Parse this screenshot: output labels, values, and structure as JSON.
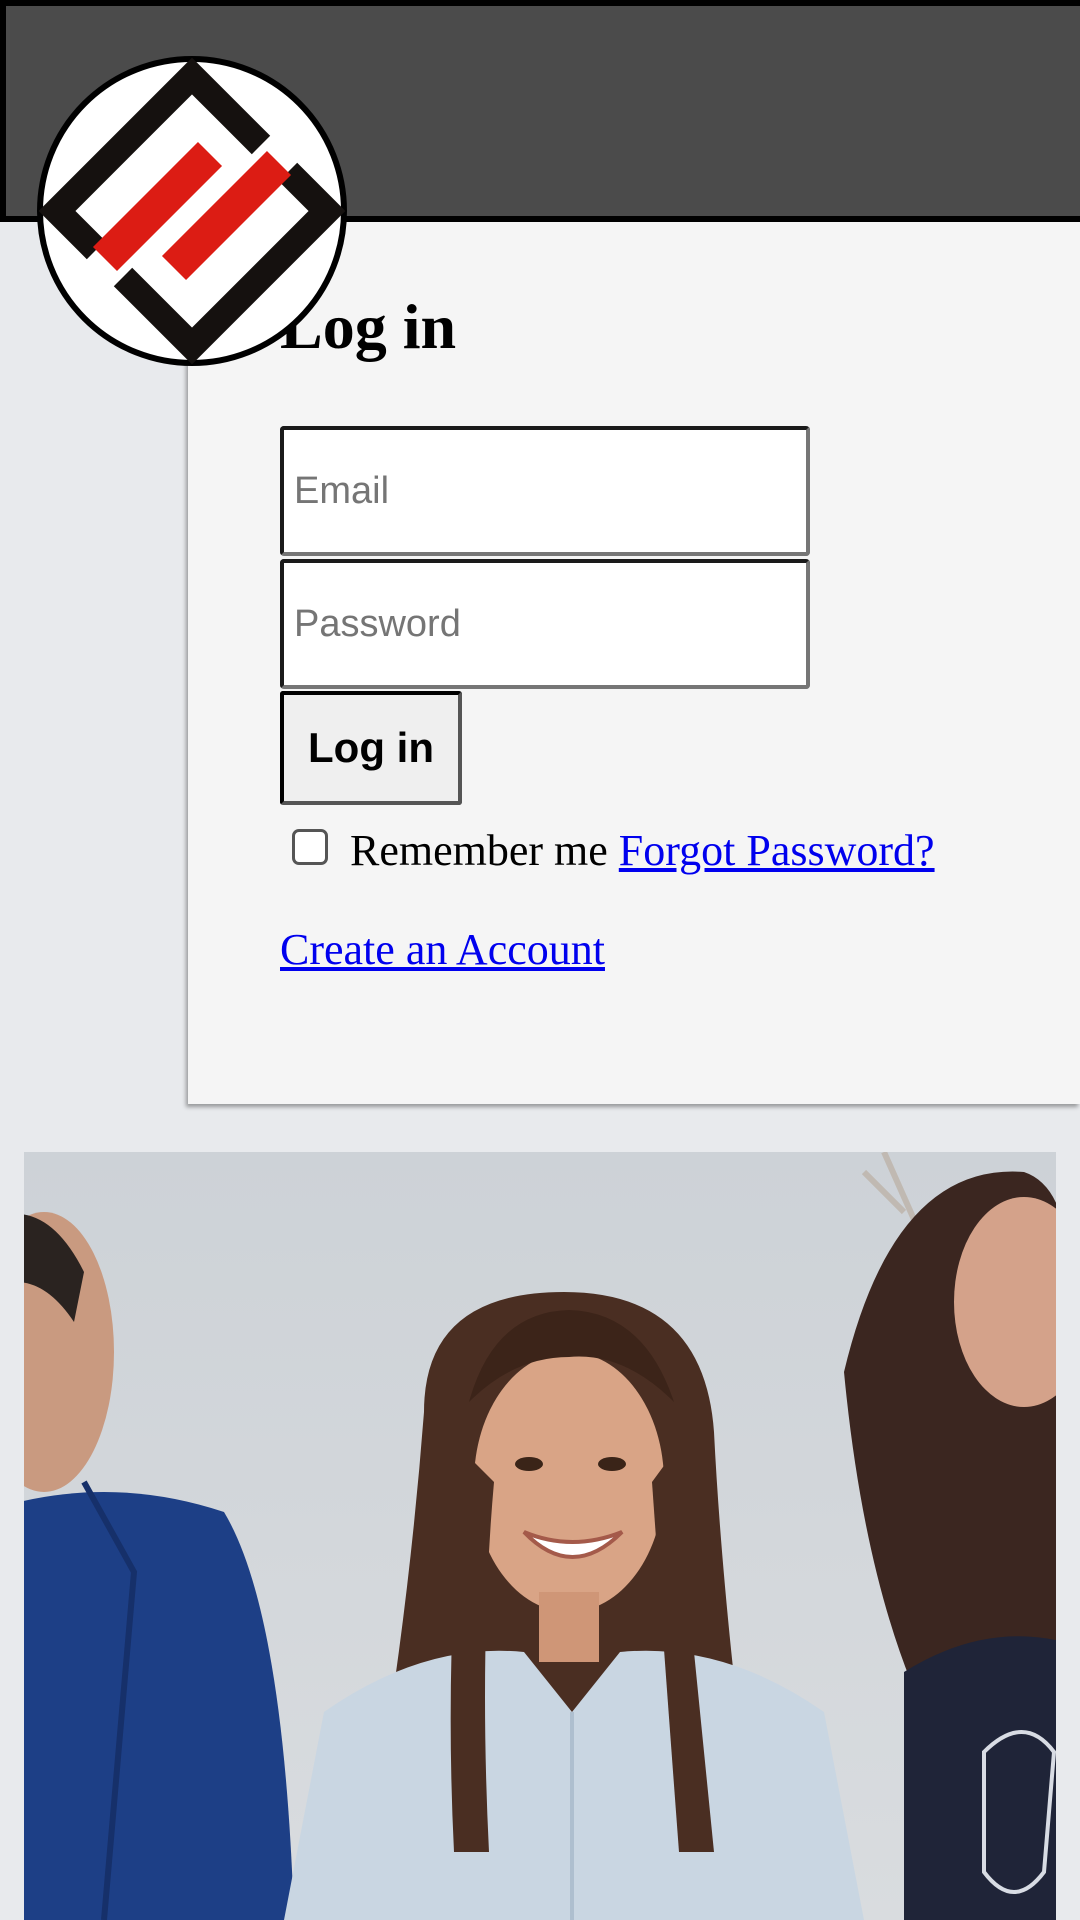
{
  "header": {
    "logo_icon": "brand-logo-icon"
  },
  "login": {
    "title": "Log in",
    "email_placeholder": "Email",
    "password_placeholder": "Password",
    "submit_label": "Log in",
    "remember_label": "Remember me",
    "remember_checked": false,
    "forgot_link": "Forgot Password?",
    "create_account_link": "Create an Account"
  },
  "hero": {
    "image_icon": "people-photo"
  },
  "colors": {
    "header_bg": "#4b4b4b",
    "card_bg": "#f5f5f5",
    "page_bg": "#e8eaed",
    "link": "#0000ee",
    "logo_red": "#dc1c14",
    "logo_black": "#15110f"
  }
}
